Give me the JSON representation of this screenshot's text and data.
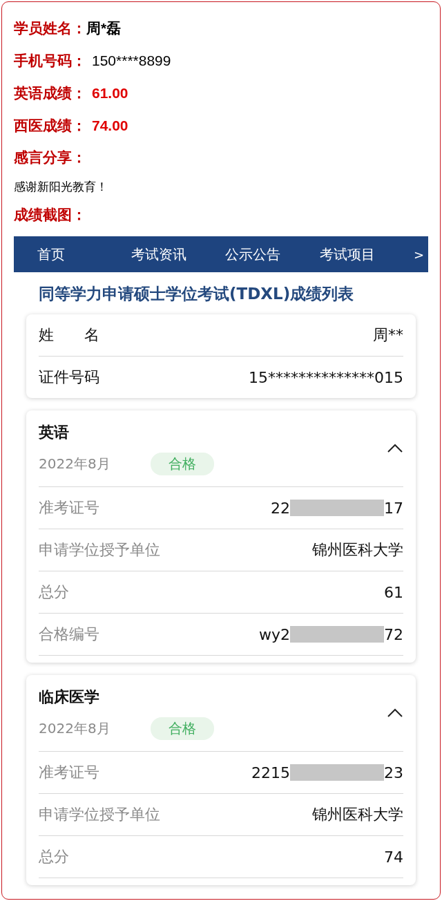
{
  "student": {
    "fields": [
      {
        "label": "学员姓名：",
        "value": "周*磊",
        "kind": "name"
      },
      {
        "label": "手机号码：",
        "value": "150****8899",
        "kind": "plain"
      },
      {
        "label": "英语成绩：",
        "value": "61.00",
        "kind": "score"
      },
      {
        "label": "西医成绩：",
        "value": "74.00",
        "kind": "score"
      }
    ],
    "comment": {
      "label": "感言分享：",
      "text": "感谢新阳光教育！"
    },
    "screenshot_label": "成绩截图："
  },
  "screenshot": {
    "nav": {
      "items": [
        {
          "label": "首页",
          "selected": false
        },
        {
          "label": "考试资讯",
          "selected": false
        },
        {
          "label": "公示公告",
          "selected": false
        },
        {
          "label": "考试项目",
          "selected": false
        }
      ],
      "more": ">"
    },
    "title": "同等学力申请硕士学位考试(TDXL)成绩列表",
    "identity": [
      {
        "label": "姓　　名",
        "value": "周**"
      },
      {
        "label": "证件号码",
        "value": "15**************015"
      }
    ],
    "subjects": [
      {
        "name": "英语",
        "date": "2022年8月",
        "status": "合格",
        "expanded": true,
        "rows": [
          {
            "label": "准考证号",
            "prefix": "22",
            "suffix": "17",
            "redacted": true
          },
          {
            "label": "申请学位授予单位",
            "value": "锦州医科大学",
            "redacted": false
          },
          {
            "label": "总分",
            "value": "61",
            "redacted": false
          },
          {
            "label": "合格编号",
            "prefix": "wy2",
            "suffix": "72",
            "redacted": true
          }
        ]
      },
      {
        "name": "临床医学",
        "date": "2022年8月",
        "status": "合格",
        "expanded": true,
        "rows": [
          {
            "label": "准考证号",
            "prefix": "2215",
            "suffix": "23",
            "redacted": true
          },
          {
            "label": "申请学位授予单位",
            "value": "锦州医科大学",
            "redacted": false
          },
          {
            "label": "总分",
            "value": "74",
            "redacted": false
          }
        ]
      }
    ]
  }
}
